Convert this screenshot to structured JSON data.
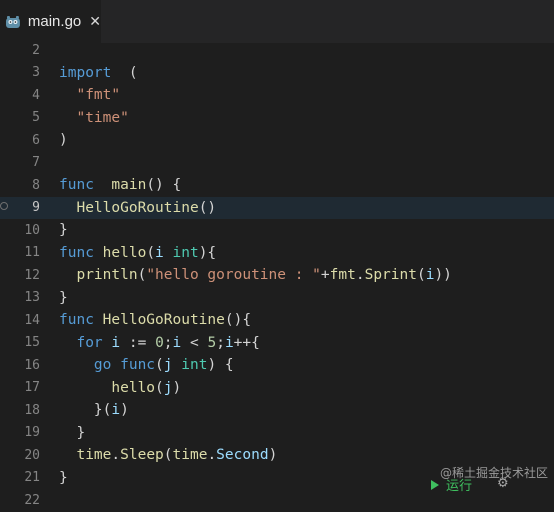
{
  "tab": {
    "label": "main.go",
    "close": "✕",
    "icon": "go-gopher-icon"
  },
  "lines": [
    {
      "n": "2",
      "tokens": []
    },
    {
      "n": "3",
      "tokens": [
        [
          "kw",
          "import"
        ],
        [
          "",
          "  ("
        ]
      ]
    },
    {
      "n": "4",
      "tokens": [
        [
          "",
          "  "
        ],
        [
          "str",
          "\"fmt\""
        ]
      ]
    },
    {
      "n": "5",
      "tokens": [
        [
          "",
          "  "
        ],
        [
          "str",
          "\"time\""
        ]
      ]
    },
    {
      "n": "6",
      "tokens": [
        [
          "",
          ")"
        ]
      ]
    },
    {
      "n": "7",
      "tokens": []
    },
    {
      "n": "8",
      "tokens": [
        [
          "kw",
          "func"
        ],
        [
          "",
          "",
          " "
        ],
        [
          "fn",
          " main"
        ],
        [
          "",
          "() {"
        ]
      ]
    },
    {
      "n": "9",
      "tokens": [
        [
          "",
          "  "
        ],
        [
          "fn",
          "HelloGoRoutine"
        ],
        [
          "",
          "()"
        ]
      ]
    },
    {
      "n": "10",
      "tokens": [
        [
          "",
          "}"
        ]
      ]
    },
    {
      "n": "11",
      "tokens": [
        [
          "kw",
          "func"
        ],
        [
          "fn",
          " hello"
        ],
        [
          "",
          "("
        ],
        [
          "var",
          "i"
        ],
        [
          "ty",
          " int"
        ],
        [
          "",
          "){"
        ]
      ]
    },
    {
      "n": "12",
      "tokens": [
        [
          "",
          "  "
        ],
        [
          "fn",
          "println"
        ],
        [
          "",
          "("
        ],
        [
          "str",
          "\"hello goroutine : \""
        ],
        [
          "",
          "+"
        ],
        [
          "pkg",
          "fmt"
        ],
        [
          "",
          "."
        ],
        [
          "fn",
          "Sprint"
        ],
        [
          "",
          "("
        ],
        [
          "var",
          "i"
        ],
        [
          "",
          "))"
        ]
      ]
    },
    {
      "n": "13",
      "tokens": [
        [
          "",
          "}"
        ]
      ]
    },
    {
      "n": "14",
      "tokens": [
        [
          "kw",
          "func"
        ],
        [
          "fn",
          " HelloGoRoutine"
        ],
        [
          "",
          "(){"
        ]
      ]
    },
    {
      "n": "15",
      "tokens": [
        [
          "",
          "  "
        ],
        [
          "kw",
          "for"
        ],
        [
          "var",
          " i"
        ],
        [
          "",
          " := "
        ],
        [
          "num",
          "0"
        ],
        [
          "",
          ";"
        ],
        [
          "var",
          "i"
        ],
        [
          "",
          " < "
        ],
        [
          "num",
          "5"
        ],
        [
          "",
          ";"
        ],
        [
          "var",
          "i"
        ],
        [
          "",
          "++{"
        ]
      ]
    },
    {
      "n": "16",
      "tokens": [
        [
          "",
          "    "
        ],
        [
          "kw",
          "go"
        ],
        [
          "kw",
          " func"
        ],
        [
          "",
          "("
        ],
        [
          "var",
          "j"
        ],
        [
          "ty",
          " int"
        ],
        [
          "",
          ") {"
        ]
      ]
    },
    {
      "n": "17",
      "tokens": [
        [
          "",
          "      "
        ],
        [
          "fn",
          "hello"
        ],
        [
          "",
          "("
        ],
        [
          "var",
          "j"
        ],
        [
          "",
          ")"
        ]
      ]
    },
    {
      "n": "18",
      "tokens": [
        [
          "",
          "    }("
        ],
        [
          "var",
          "i"
        ],
        [
          "",
          ")"
        ]
      ]
    },
    {
      "n": "19",
      "tokens": [
        [
          "",
          "  }"
        ]
      ]
    },
    {
      "n": "20",
      "tokens": [
        [
          "",
          "  "
        ],
        [
          "pkg",
          "time"
        ],
        [
          "",
          "."
        ],
        [
          "fn",
          "Sleep"
        ],
        [
          "",
          "("
        ],
        [
          "pkg",
          "time"
        ],
        [
          "",
          "."
        ],
        [
          "var",
          "Second"
        ],
        [
          "",
          ")"
        ]
      ]
    },
    {
      "n": "21",
      "tokens": [
        [
          "",
          "}"
        ]
      ]
    },
    {
      "n": "22",
      "tokens": []
    }
  ],
  "current_line": "9",
  "run": {
    "label": "运行",
    "icon": "run-triangle-icon"
  },
  "watermark": "@稀土掘金技术社区",
  "colors": {
    "background": "#1e1e1e",
    "keyword": "#569cd6",
    "string": "#ce9178",
    "function": "#dcdcaa",
    "type": "#4ec9b0",
    "number": "#b5cea8",
    "variable": "#9cdcfe"
  }
}
